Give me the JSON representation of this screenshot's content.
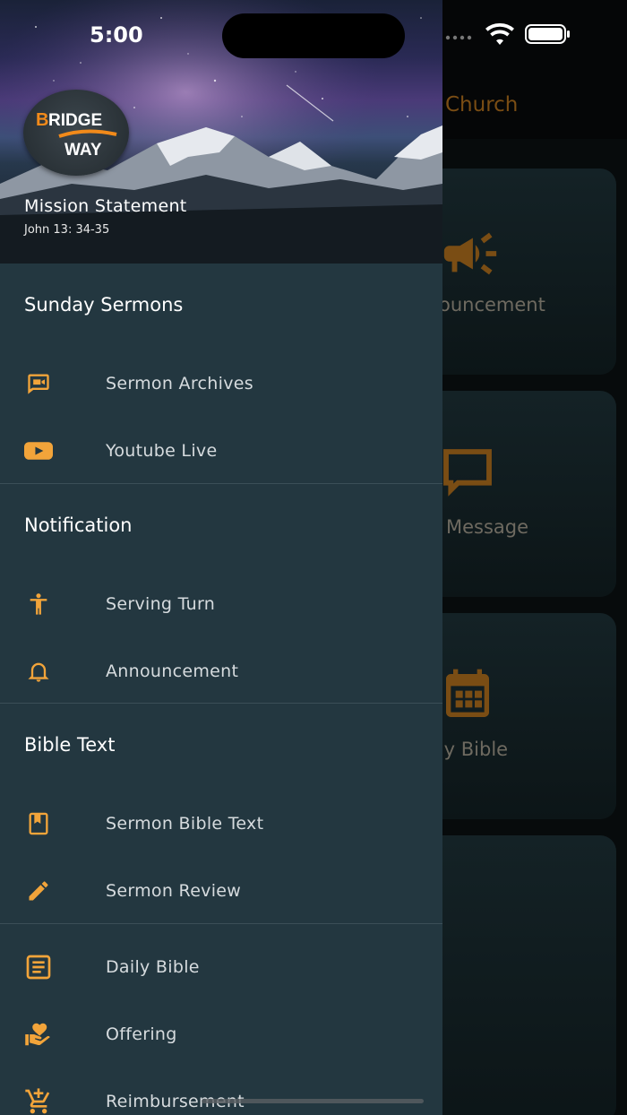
{
  "status_bar": {
    "time": "5:00"
  },
  "background": {
    "title": "Church",
    "cards": [
      {
        "label": "ouncement",
        "icon": "megaphone-icon"
      },
      {
        "label": "Message",
        "icon": "chat-bubble-icon"
      },
      {
        "label": "ily Bible",
        "icon": "calendar-icon"
      },
      {
        "label": "",
        "icon": ""
      }
    ]
  },
  "drawer": {
    "logo": {
      "line1": "BRIDGE",
      "line2": "WAY"
    },
    "hero_title": "Mission Statement",
    "hero_subtitle": "John 13: 34-35",
    "sections": [
      {
        "title": "Sunday Sermons",
        "items": [
          {
            "label": "Sermon Archives",
            "icon": "video-chat-icon"
          },
          {
            "label": "Youtube Live",
            "icon": "youtube-icon"
          }
        ]
      },
      {
        "title": "Notification",
        "items": [
          {
            "label": "Serving Turn",
            "icon": "person-icon"
          },
          {
            "label": "Announcement",
            "icon": "bell-icon"
          }
        ]
      },
      {
        "title": "Bible Text",
        "items": [
          {
            "label": "Sermon Bible Text",
            "icon": "bookmark-book-icon"
          },
          {
            "label": "Sermon Review",
            "icon": "pencil-icon"
          }
        ]
      },
      {
        "title": "",
        "items": [
          {
            "label": "Daily Bible",
            "icon": "article-icon"
          },
          {
            "label": "Offering",
            "icon": "heart-hand-icon"
          },
          {
            "label": "Reimbursement",
            "icon": "cart-add-icon"
          }
        ]
      }
    ]
  },
  "colors": {
    "accent": "#f2a43a",
    "drawer_bg": "#233740",
    "divider": "#3b4e57",
    "bg_accent_dim": "#7a4d14"
  }
}
